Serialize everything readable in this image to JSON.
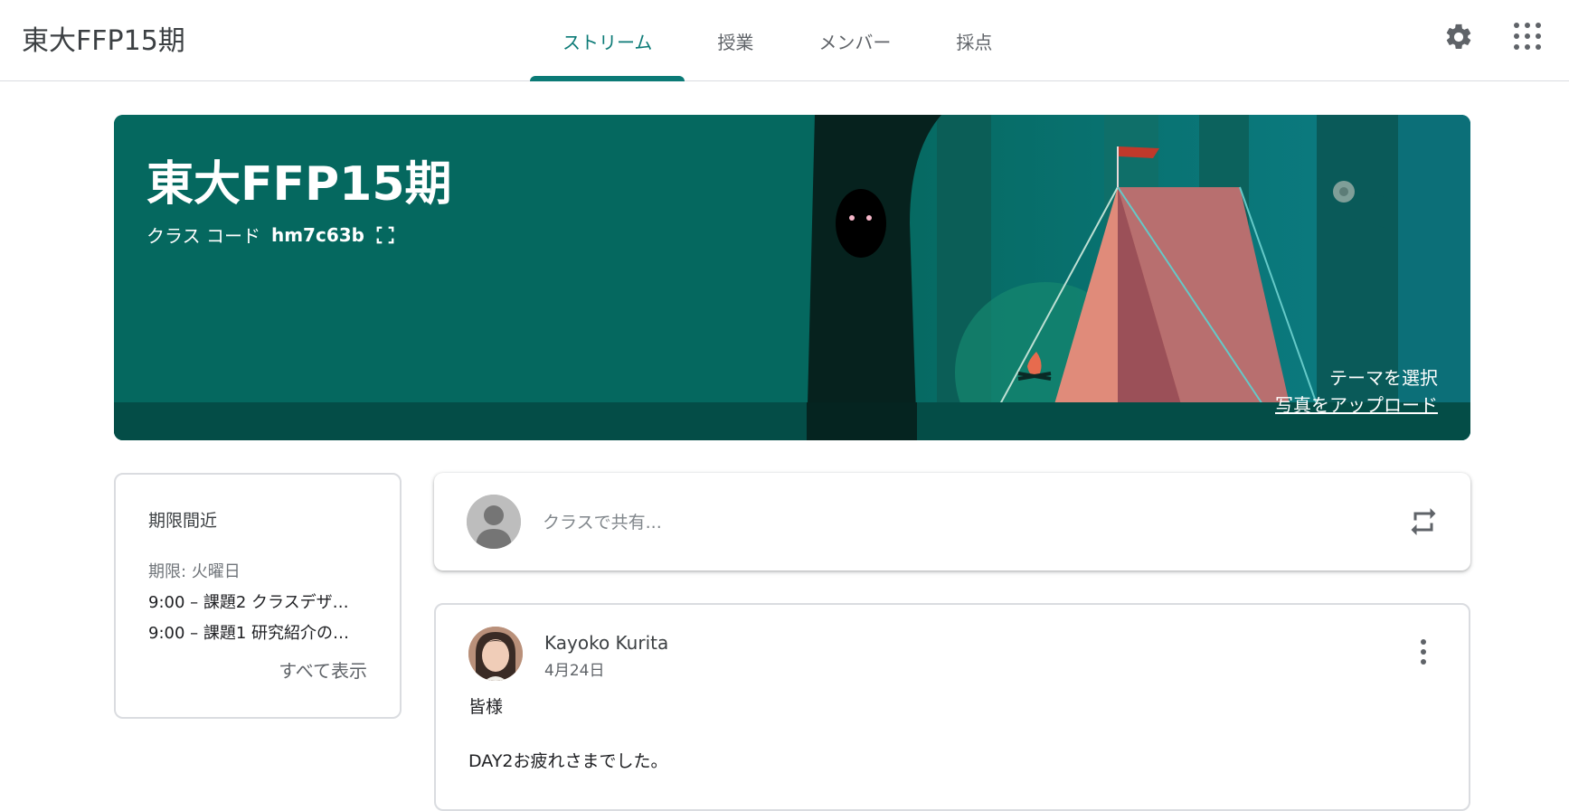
{
  "header": {
    "app_title": "東大FFP15期",
    "tabs": [
      {
        "label": "ストリーム",
        "active": true
      },
      {
        "label": "授業",
        "active": false
      },
      {
        "label": "メンバー",
        "active": false
      },
      {
        "label": "採点",
        "active": false
      }
    ],
    "icons": [
      "gear-icon",
      "apps-grid-icon"
    ],
    "accent_color": "#0b7a76"
  },
  "banner": {
    "title": "東大FFP15期",
    "class_code_label": "クラス コード",
    "class_code": "hm7c63b",
    "select_theme": "テーマを選択",
    "upload_photo": "写真をアップロード",
    "theme_color": "#05685f"
  },
  "upcoming": {
    "heading": "期限間近",
    "due_label": "期限: 火曜日",
    "items": [
      "9:00 – 課題2 クラスデザ…",
      "9:00 – 課題1 研究紹介の…"
    ],
    "view_all": "すべて表示"
  },
  "share": {
    "placeholder": "クラスで共有..."
  },
  "post": {
    "author": "Kayoko Kurita",
    "date": "4月24日",
    "line1": "皆様",
    "line2": "DAY2お疲れさまでした。"
  }
}
